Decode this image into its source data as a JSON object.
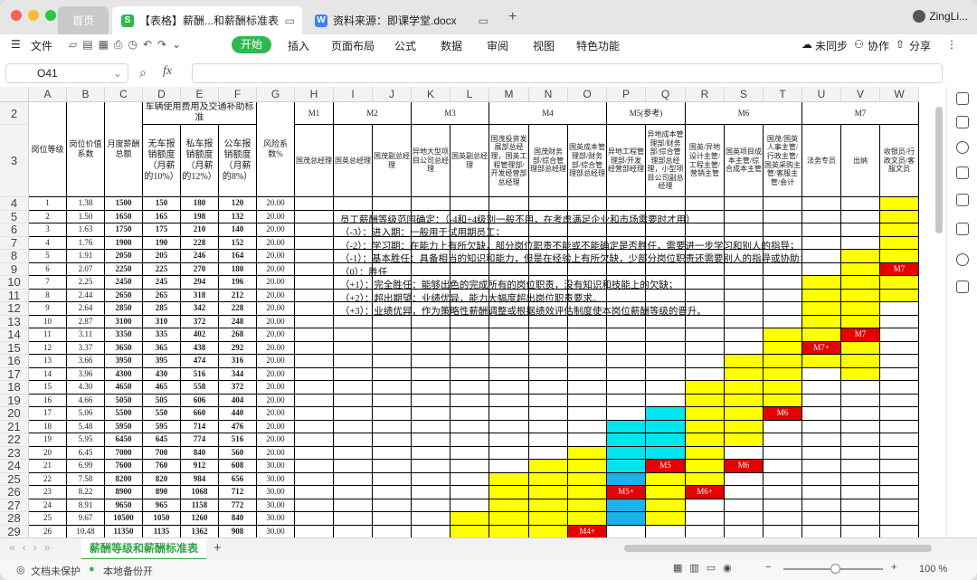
{
  "window": {
    "tabs": [
      {
        "label": "首页"
      },
      {
        "label": "【表格】薪酬...和薪酬标准表",
        "icon": "S"
      },
      {
        "label": "资料来源：即课学堂.docx",
        "icon": "W"
      }
    ],
    "user": "ZingLi..."
  },
  "menu": {
    "file": "文件",
    "items": [
      "开始",
      "插入",
      "页面布局",
      "公式",
      "数据",
      "审阅",
      "视图",
      "特色功能"
    ],
    "right": [
      "未同步",
      "协作",
      "分享"
    ]
  },
  "formula": {
    "cellref": "O41",
    "fx": "fx",
    "value": ""
  },
  "columns": [
    "A",
    "B",
    "C",
    "D",
    "E",
    "F",
    "G",
    "H",
    "I",
    "J",
    "K",
    "L",
    "M",
    "N",
    "O",
    "P",
    "Q",
    "R",
    "S",
    "T",
    "U",
    "V",
    "W"
  ],
  "rows": [
    "2",
    "3",
    "4",
    "5",
    "6",
    "7",
    "8",
    "9",
    "10",
    "11",
    "12",
    "13",
    "14",
    "15",
    "16",
    "17",
    "18",
    "19",
    "20",
    "21",
    "22",
    "23",
    "24",
    "25",
    "26",
    "27",
    "28",
    "29"
  ],
  "header2": {
    "vehicle": "车辆使用费用及交通补助标准",
    "m1": "M1",
    "m2": "M2",
    "m3": "M3",
    "m4": "M4",
    "m5": "M5(参考)",
    "m6": "M6",
    "m7": "M7"
  },
  "header3": {
    "a": "岗位等级",
    "b": "岗位价值系数",
    "c": "月度薪酬总额",
    "d": "无车报销额度（月薪的10%）",
    "e": "私车报销额度（月薪的12%）",
    "f": "公车报销额度（月薪的8%）",
    "g": "风险系数%",
    "h": "国茂总经理",
    "i": "国英总经理",
    "j": "国茂副总经理",
    "k": "异地大型项目公司总经理",
    "l": "国英副总经理",
    "m": "国茂投资发展部总经理，国英工程管理部/开发经营部总经理",
    "n": "国茂财务部/综合管理部总经理",
    "o": "国英成本管理部/财务部/综合管理部总经理",
    "p": "异地工程管理部/开发经营部经理",
    "q": "异地成本管理部/财务部/综合管理部总经理，小型项目公司副总经理",
    "r": "国英/异地设计主管/工程主管/营销主管",
    "s": "国英项目成本主管/综合成本主管",
    "t": "国茂/国英人事主管/行政主管/国英采购主管/客服主管/会计",
    "u": "法务专员",
    "v": "出纳",
    "w": "收银员/行政文员/客服文员"
  },
  "table_rows": [
    [
      "1",
      "1.38",
      "1500",
      "150",
      "180",
      "120",
      "20.00"
    ],
    [
      "2",
      "1.50",
      "1650",
      "165",
      "198",
      "132",
      "20.00"
    ],
    [
      "3",
      "1.63",
      "1750",
      "175",
      "210",
      "140",
      "20.00"
    ],
    [
      "4",
      "1.76",
      "1900",
      "190",
      "228",
      "152",
      "20.00"
    ],
    [
      "5",
      "1.91",
      "2050",
      "205",
      "246",
      "164",
      "20.00"
    ],
    [
      "6",
      "2.07",
      "2250",
      "225",
      "270",
      "180",
      "20.00"
    ],
    [
      "7",
      "2.25",
      "2450",
      "245",
      "294",
      "196",
      "20.00"
    ],
    [
      "8",
      "2.44",
      "2650",
      "265",
      "318",
      "212",
      "20.00"
    ],
    [
      "9",
      "2.64",
      "2850",
      "285",
      "342",
      "228",
      "20.00"
    ],
    [
      "10",
      "2.87",
      "3100",
      "310",
      "372",
      "248",
      "20.00"
    ],
    [
      "11",
      "3.11",
      "3350",
      "335",
      "402",
      "268",
      "20.00"
    ],
    [
      "12",
      "3.37",
      "3650",
      "365",
      "438",
      "292",
      "20.00"
    ],
    [
      "13",
      "3.66",
      "3950",
      "395",
      "474",
      "316",
      "20.00"
    ],
    [
      "14",
      "3.96",
      "4300",
      "430",
      "516",
      "344",
      "20.00"
    ],
    [
      "15",
      "4.30",
      "4650",
      "465",
      "558",
      "372",
      "20.00"
    ],
    [
      "16",
      "4.66",
      "5050",
      "505",
      "606",
      "404",
      "20.00"
    ],
    [
      "17",
      "5.06",
      "5500",
      "550",
      "660",
      "440",
      "20.00"
    ],
    [
      "18",
      "5.48",
      "5950",
      "595",
      "714",
      "476",
      "20.00"
    ],
    [
      "19",
      "5.95",
      "6450",
      "645",
      "774",
      "516",
      "20.00"
    ],
    [
      "20",
      "6.45",
      "7000",
      "700",
      "840",
      "560",
      "20.00"
    ],
    [
      "21",
      "6.99",
      "7600",
      "760",
      "912",
      "608",
      "30.00"
    ],
    [
      "22",
      "7.58",
      "8200",
      "820",
      "984",
      "656",
      "30.00"
    ],
    [
      "23",
      "8.22",
      "8900",
      "890",
      "1068",
      "712",
      "30.00"
    ],
    [
      "24",
      "8.91",
      "9650",
      "965",
      "1158",
      "772",
      "30.00"
    ],
    [
      "25",
      "9.67",
      "10500",
      "1050",
      "1260",
      "840",
      "30.00"
    ],
    [
      "26",
      "10.48",
      "11350",
      "1135",
      "1362",
      "908",
      "30.00"
    ]
  ],
  "notes": [
    "员工薪酬等级范围确定：（-4和+4级别一般不用，在考虑满足企业和市场需要时才用）",
    "（-3）：进入期：一般用于试用期员工；",
    "（-2）：学习期：在能力上有所欠缺，部分岗位职责不能或不能确定是否胜任，需要进一步学习和别人的指导；",
    "（-1）：基本胜任：具备相当的知识和能力，但是在经验上有所欠缺，少部分岗位职责还需要别人的指导或协助；",
    "（0）：胜任",
    "（+1）：完全胜任：能够出色的完成所有的岗位职责，没有知识和技能上的欠缺；",
    "（+2）：超出期望：业绩优异，能力大幅度超出岗位职责要求。",
    "（+3）：业绩优异，作为策略性薪酬调整或根据绩效评估制度使本岗位薪酬等级的晋升。"
  ],
  "marks": {
    "m7": "M7",
    "m7plus": "M7+",
    "m6": "M6",
    "m5": "M5",
    "m6b": "M6",
    "m5plus": "M5+",
    "m6plus": "M6+",
    "m4plus": "M4+"
  },
  "colors": {
    "yellow": "#ffff00",
    "cyan": "#00e6f0",
    "blue": "#1ab2e8",
    "red": "#e60000",
    "accent": "#2fb84f"
  },
  "sheet": {
    "name": "薪酬等级和薪酬标准表",
    "add": "+"
  },
  "status": {
    "protect": "文档未保护",
    "backup": "本地备份开",
    "zoom": "100 %"
  }
}
